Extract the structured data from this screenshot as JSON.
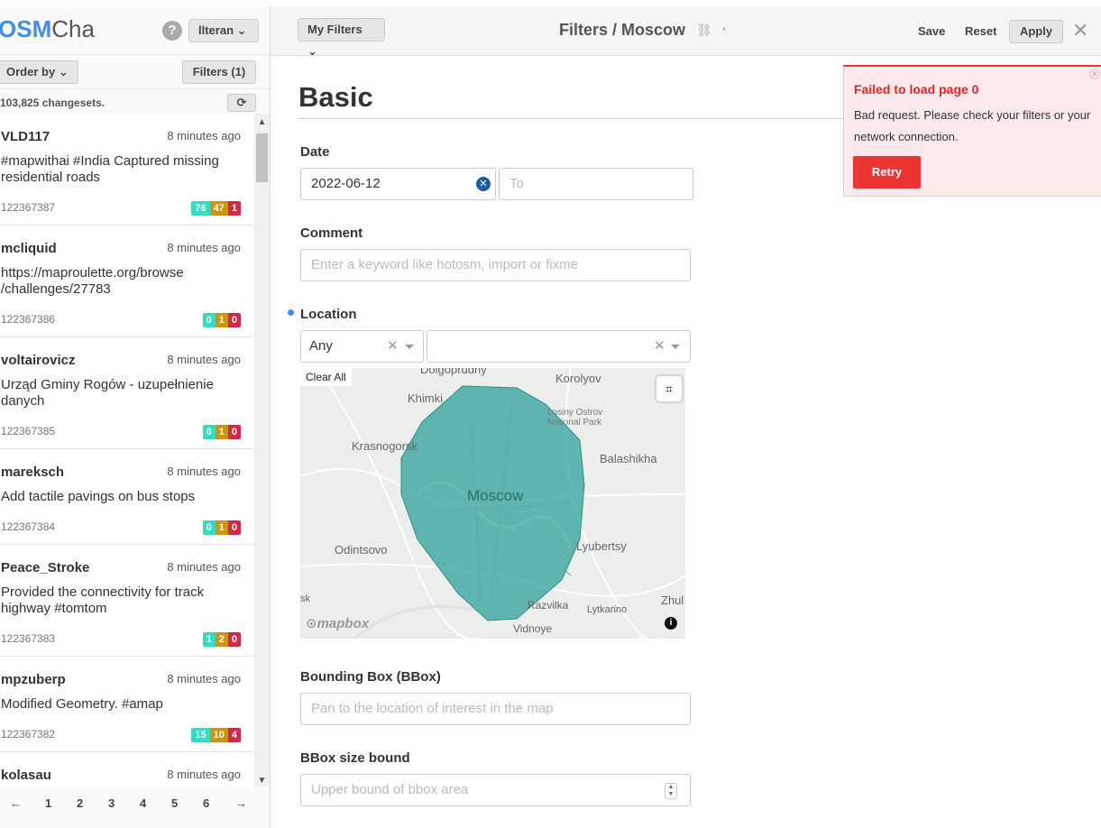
{
  "app": {
    "logo_osm": "OSM",
    "logo_cha": "Cha"
  },
  "sidebar": {
    "help_label": "?",
    "user_label": "llteran",
    "order_by_label": "Order by",
    "filters_label": "Filters (1)",
    "count_label": "103,825 changesets.",
    "refresh_label": "⟳",
    "items": [
      {
        "user": "VLD117",
        "time": "8 minutes ago",
        "comment": "#mapwithai #India Captured missing residential roads",
        "id": "122367387",
        "create": "76",
        "modify": "47",
        "delete": "1"
      },
      {
        "user": "mcliquid",
        "time": "8 minutes ago",
        "comment": "https://maproulette.org/browse /challenges/27783",
        "id": "122367386",
        "create": "0",
        "modify": "1",
        "delete": "0"
      },
      {
        "user": "voltairovicz",
        "time": "8 minutes ago",
        "comment": "Urząd Gminy Rogów - uzupełnienie danych",
        "id": "122367385",
        "create": "0",
        "modify": "1",
        "delete": "0"
      },
      {
        "user": "mareksch",
        "time": "8 minutes ago",
        "comment": "Add tactile pavings on bus stops",
        "id": "122367384",
        "create": "0",
        "modify": "1",
        "delete": "0"
      },
      {
        "user": "Peace_Stroke",
        "time": "8 minutes ago",
        "comment": "Provided the connectivity for track highway #tomtom",
        "id": "122367383",
        "create": "1",
        "modify": "2",
        "delete": "0"
      },
      {
        "user": "mpzuberp",
        "time": "8 minutes ago",
        "comment": "Modified Geometry. #amap",
        "id": "122367382",
        "create": "15",
        "modify": "10",
        "delete": "4"
      },
      {
        "user": "kolasau",
        "time": "8 minutes ago",
        "comment": "",
        "id": "",
        "create": "",
        "modify": "",
        "delete": ""
      }
    ],
    "pager": [
      "←",
      "1",
      "2",
      "3",
      "4",
      "5",
      "6",
      "→"
    ]
  },
  "header": {
    "my_filters_label": "My Filters",
    "title": "Filters / Moscow",
    "save_label": "Save",
    "reset_label": "Reset",
    "apply_label": "Apply",
    "close_label": "✕"
  },
  "main": {
    "section_title": "Basic",
    "date": {
      "label": "Date",
      "from_value": "2022-06-12",
      "to_placeholder": "To"
    },
    "comment": {
      "label": "Comment",
      "placeholder": "Enter a keyword like hotosm, import or fixme"
    },
    "location": {
      "label": "Location",
      "mode_value": "Any",
      "map_clear_label": "Clear All",
      "places": [
        "Dolgoprudny",
        "Korolyov",
        "Khimki",
        "Losiny Ostrov National Park",
        "Krasnogorsk",
        "Balashikha",
        "Moscow",
        "Odintsovo",
        "Lyubertsy",
        "Razvilka",
        "Lytkarino",
        "Zhul",
        "Vidnoye",
        "sk"
      ],
      "attribution": "mapbox"
    },
    "bbox": {
      "label": "Bounding Box (BBox)",
      "placeholder": "Pan to the location of interest in the map"
    },
    "bbox_size": {
      "label": "BBox size bound",
      "placeholder": "Upper bound of bbox area"
    }
  },
  "toast": {
    "title": "Failed to load page 0",
    "body": "Bad request. Please check your filters or your network connection.",
    "retry_label": "Retry"
  },
  "colors": {
    "accent": "#448ee4",
    "error": "#ee3333",
    "polygon": "#3ba6a0",
    "create": "#39dbc0",
    "modify": "#cc9415",
    "delete": "#cc2c47"
  }
}
